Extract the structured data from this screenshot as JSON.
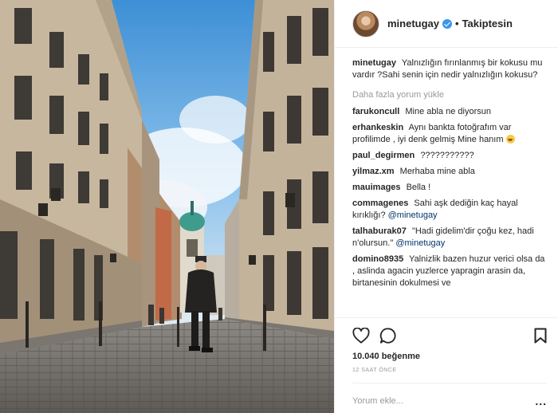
{
  "header": {
    "username": "minetugay",
    "separator": "•",
    "follow_status": "Takiptesin"
  },
  "caption": {
    "username": "minetugay",
    "text": "Yalnızlığın fırınlanmış bir kokusu mu vardır ?Sahi senin için nedir yalnızlığın kokusu?"
  },
  "load_more": "Daha fazla yorum yükle",
  "comments": [
    {
      "user": "farukoncull",
      "text": "Mine abla ne diyorsun"
    },
    {
      "user": "erhankeskin",
      "text": "Aynı bankta fotoğrafım var profilimde , iyi denk gelmiş Mine hanım"
    },
    {
      "user": "paul_degirmen",
      "text": "???????????"
    },
    {
      "user": "yilmaz.xm",
      "text": "Merhaba mine abla"
    },
    {
      "user": "mauimages",
      "text": "Bella !"
    },
    {
      "user": "commagenes",
      "text": "Sahi aşk dediğin kaç hayal kırıklığı?",
      "mention": "@minetugay"
    },
    {
      "user": "talhaburak07",
      "text": "\"Hadi gidelim'dir çoğu kez, hadi n'olursun.\"",
      "mention": "@minetugay"
    },
    {
      "user": "domino8935",
      "text": "Yalnizlik bazen huzur verici olsa da , aslinda agacin yuzlerce yapragin arasin da, birtanesinin dokulmesi ve"
    }
  ],
  "icons": {
    "like": "heart-icon",
    "comment": "speech-bubble-icon",
    "save": "bookmark-icon",
    "options": "more-options-icon"
  },
  "likes": "10.040 beğenme",
  "timestamp": "12 SAAT ÖNCE",
  "add_comment_placeholder": "Yorum ekle...",
  "options_glyph": "...",
  "colors": {
    "verified": "#3897f0",
    "mention": "#003569",
    "muted": "#999999",
    "text": "#262626"
  }
}
